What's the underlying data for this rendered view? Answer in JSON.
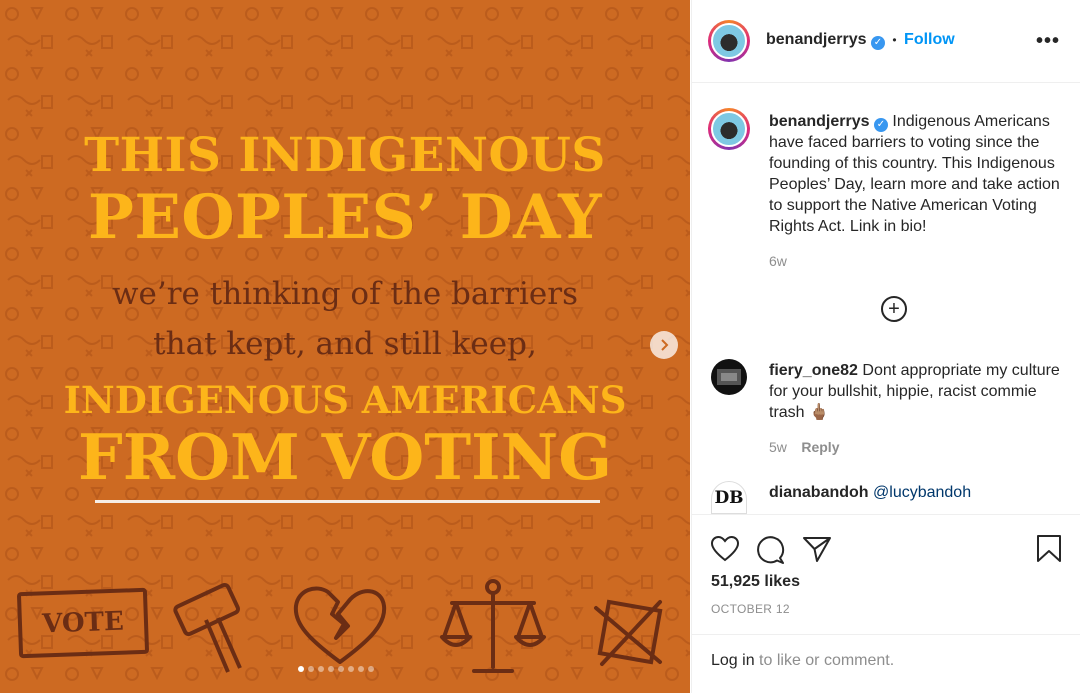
{
  "post": {
    "headline_line1": "THIS INDIGENOUS",
    "headline_line2": "PEOPLES’ DAY",
    "headline_line3": "we’re thinking of the barriers",
    "headline_line4": "that kept, and still keep,",
    "headline_line5": "INDIGENOUS AMERICANS",
    "headline_line6": "FROM VOTING",
    "sign_text": "VOTE",
    "carousel": {
      "total": 8,
      "active_index": 1
    }
  },
  "header": {
    "username": "benandjerrys",
    "bullet": "•",
    "follow_label": "Follow",
    "more_label": "•••"
  },
  "caption": {
    "username": "benandjerrys",
    "text": "Indigenous Americans have faced barriers to voting since the founding of this country. This Indigenous Peoples’ Day, learn more and take action to support the Native American Voting Rights Act. Link in bio!",
    "age": "6w"
  },
  "load_more_label": "+",
  "comments": [
    {
      "username": "fiery_one82",
      "text": "Dont appropriate my culture for your bullshit, hippie, racist commie trash",
      "emoji": "🖕🏽",
      "age": "5w",
      "reply_label": "Reply"
    },
    {
      "username": "dianabandoh",
      "mention": "@lucybandoh",
      "avatar_text": "DB"
    }
  ],
  "actions": {
    "likes": "51,925 likes",
    "date": "OCTOBER 12"
  },
  "login": {
    "link_label": "Log in",
    "rest": " to like or comment."
  },
  "colors": {
    "background": "#cd6a22",
    "headline_yellow": "#fdb51a",
    "headline_brown": "#6b2d14",
    "follow_blue": "#0095f6"
  }
}
